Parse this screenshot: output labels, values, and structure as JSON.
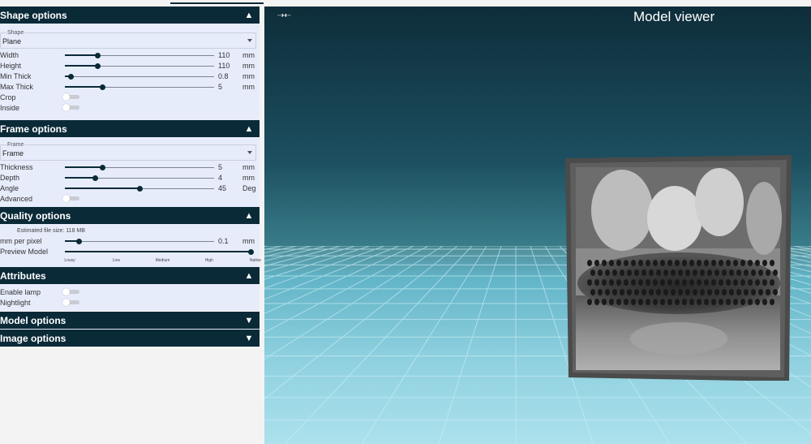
{
  "sections": {
    "shape": {
      "title": "Shape options",
      "select_label": "Shape",
      "select_value": "Plane",
      "sliders": [
        {
          "name": "Width",
          "value": "110",
          "unit": "mm",
          "level": 0.22
        },
        {
          "name": "Height",
          "value": "110",
          "unit": "mm",
          "level": 0.22
        },
        {
          "name": "Min Thick",
          "value": "0.8",
          "unit": "mm",
          "level": 0.04
        },
        {
          "name": "Max Thick",
          "value": "5",
          "unit": "mm",
          "level": 0.25
        }
      ],
      "toggles": [
        {
          "name": "Crop",
          "on": false
        },
        {
          "name": "Inside",
          "on": false
        }
      ]
    },
    "frame": {
      "title": "Frame options",
      "select_label": "Frame",
      "select_value": "Frame",
      "sliders": [
        {
          "name": "Thickness",
          "value": "5",
          "unit": "mm",
          "level": 0.25
        },
        {
          "name": "Depth",
          "value": "4",
          "unit": "mm",
          "level": 0.2
        },
        {
          "name": "Angle",
          "value": "45",
          "unit": "Deg",
          "level": 0.5
        }
      ],
      "toggles": [
        {
          "name": "Advanced",
          "on": false
        }
      ]
    },
    "quality": {
      "title": "Quality options",
      "file_size": "Estimated file size: 118 MB",
      "slider": {
        "name": "mm per pixel",
        "value": "0.1",
        "unit": "mm",
        "level": 0.09
      },
      "preview_label": "Preview Model",
      "preview_level": 1.0,
      "preview_ticks": [
        "Lousy",
        "Low",
        "Medium",
        "High",
        "Native"
      ]
    },
    "attributes": {
      "title": "Attributes",
      "toggles": [
        {
          "name": "Enable lamp",
          "on": false
        },
        {
          "name": "Nightlight",
          "on": false
        }
      ]
    },
    "model": {
      "title": "Model options"
    },
    "image": {
      "title": "Image options"
    }
  },
  "viewer": {
    "title": "Model viewer",
    "corner_icon": "collapse-arrows-icon"
  },
  "colors": {
    "header": "#0b2a38",
    "panel_body": "#e7ecfb",
    "accent": "#0b2a38"
  }
}
